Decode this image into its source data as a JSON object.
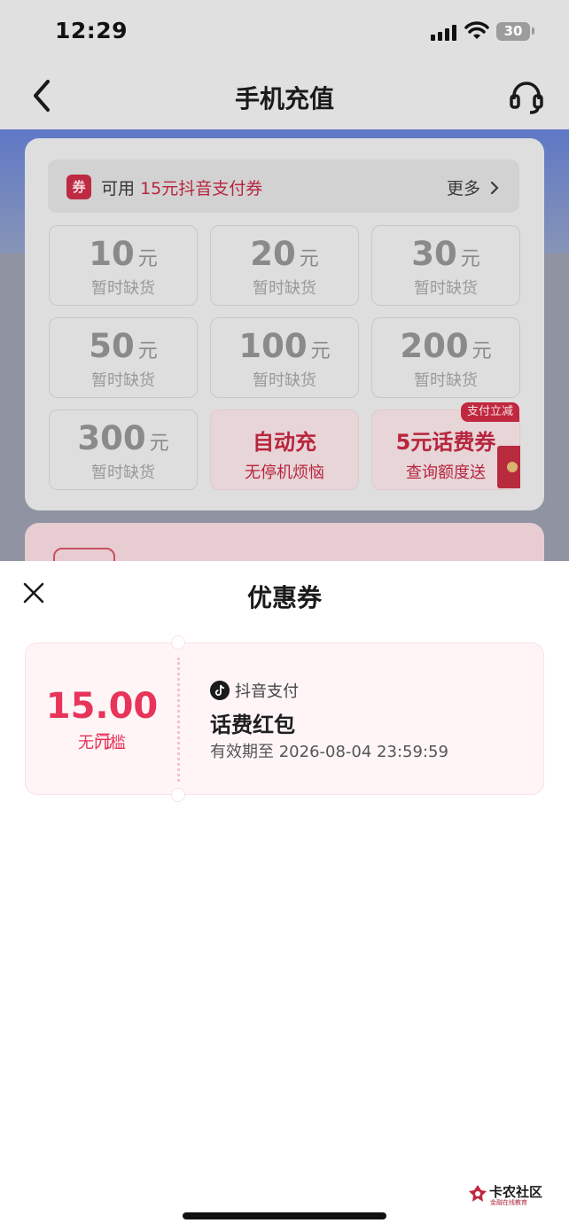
{
  "status_bar": {
    "time": "12:29",
    "battery": "30"
  },
  "nav": {
    "title": "手机充值"
  },
  "coupon_bar": {
    "badge": "券",
    "prefix": "可用",
    "highlight": "15元抖音支付券",
    "more": "更多"
  },
  "amounts": [
    {
      "value": "10",
      "unit": "元",
      "status": "暂时缺货"
    },
    {
      "value": "20",
      "unit": "元",
      "status": "暂时缺货"
    },
    {
      "value": "30",
      "unit": "元",
      "status": "暂时缺货"
    },
    {
      "value": "50",
      "unit": "元",
      "status": "暂时缺货"
    },
    {
      "value": "100",
      "unit": "元",
      "status": "暂时缺货"
    },
    {
      "value": "200",
      "unit": "元",
      "status": "暂时缺货"
    },
    {
      "value": "300",
      "unit": "元",
      "status": "暂时缺货"
    }
  ],
  "promos": {
    "auto_recharge": {
      "title": "自动充",
      "subtitle": "无停机烦恼"
    },
    "voucher": {
      "tag": "支付立减",
      "title": "5元话费券",
      "subtitle": "查询额度送"
    }
  },
  "sheet": {
    "title": "优惠券",
    "coupon": {
      "amount": "15.00",
      "unit": "元",
      "threshold": "无门槛",
      "brand": "抖音支付",
      "name": "话费红包",
      "expiry": "有效期至 2026-08-04 23:59:59"
    }
  },
  "watermark": {
    "name": "卡农社区",
    "sub": "金融在线教育"
  },
  "colors": {
    "accent": "#e8345a",
    "dim_red": "#b8253d"
  }
}
